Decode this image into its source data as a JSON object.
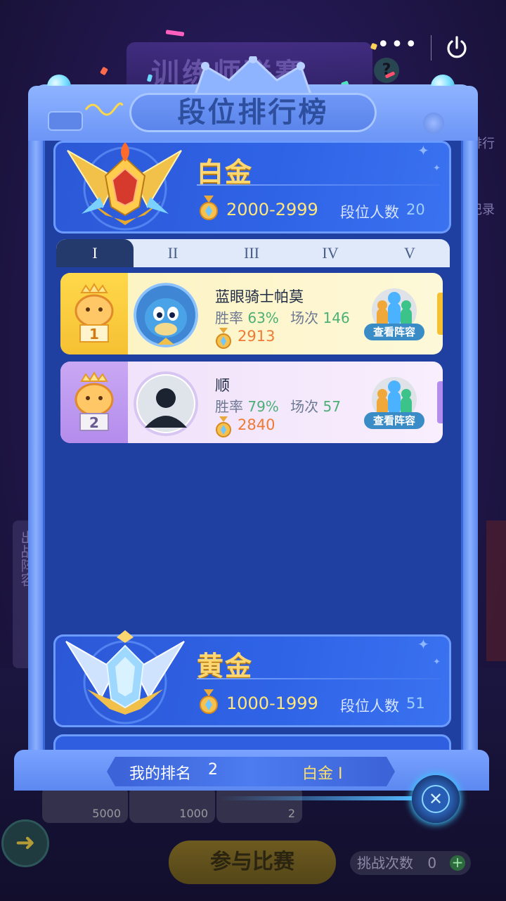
{
  "modal": {
    "title": "段位排行榜",
    "tabs": [
      {
        "label": "I",
        "active": true
      },
      {
        "label": "II",
        "active": false
      },
      {
        "label": "III",
        "active": false
      },
      {
        "label": "IV",
        "active": false
      },
      {
        "label": "V",
        "active": false
      }
    ],
    "tiers": [
      {
        "name": "白金",
        "range": "2000-2999",
        "count_label": "段位人数",
        "count": "20"
      },
      {
        "name": "黄金",
        "range": "1000-1999",
        "count_label": "段位人数",
        "count": "51"
      }
    ],
    "players": [
      {
        "rank": "1",
        "name": "蓝眼骑士帕莫",
        "win_label": "胜率",
        "win_rate": "63%",
        "games_label": "场次",
        "games": "146",
        "score": "2913",
        "team_button": "查看阵容"
      },
      {
        "rank": "2",
        "name": "顺",
        "win_label": "胜率",
        "win_rate": "79%",
        "games_label": "场次",
        "games": "57",
        "score": "2840",
        "team_button": "查看阵容"
      }
    ],
    "my_rank": {
      "label": "我的排名",
      "value": "2",
      "tier": "白金 I"
    }
  },
  "capsule": {
    "more": "•••"
  },
  "background": {
    "banner": "训练师联赛",
    "help": "?",
    "side_items": [
      "排行",
      "记录"
    ],
    "left_panel": "出战阵容",
    "cards": [
      "5000",
      "1000",
      "2"
    ],
    "join_button": "参与比赛",
    "challenge_label": "挑战次数",
    "challenge_count": "0",
    "challenge_add": "+"
  },
  "colors": {
    "frame": "#6f98f7",
    "panel": "#1f3fa1",
    "gold_text": "#ffd770",
    "range_text": "#ffe77c",
    "win_green": "#4caf75",
    "score_orange": "#f07a34",
    "row1_bg": "#fdf6cf",
    "row2_bg": "#f5eafc"
  },
  "icons": [
    "power-icon",
    "more-icon",
    "close-icon",
    "medal-icon",
    "back-arrow-icon"
  ]
}
